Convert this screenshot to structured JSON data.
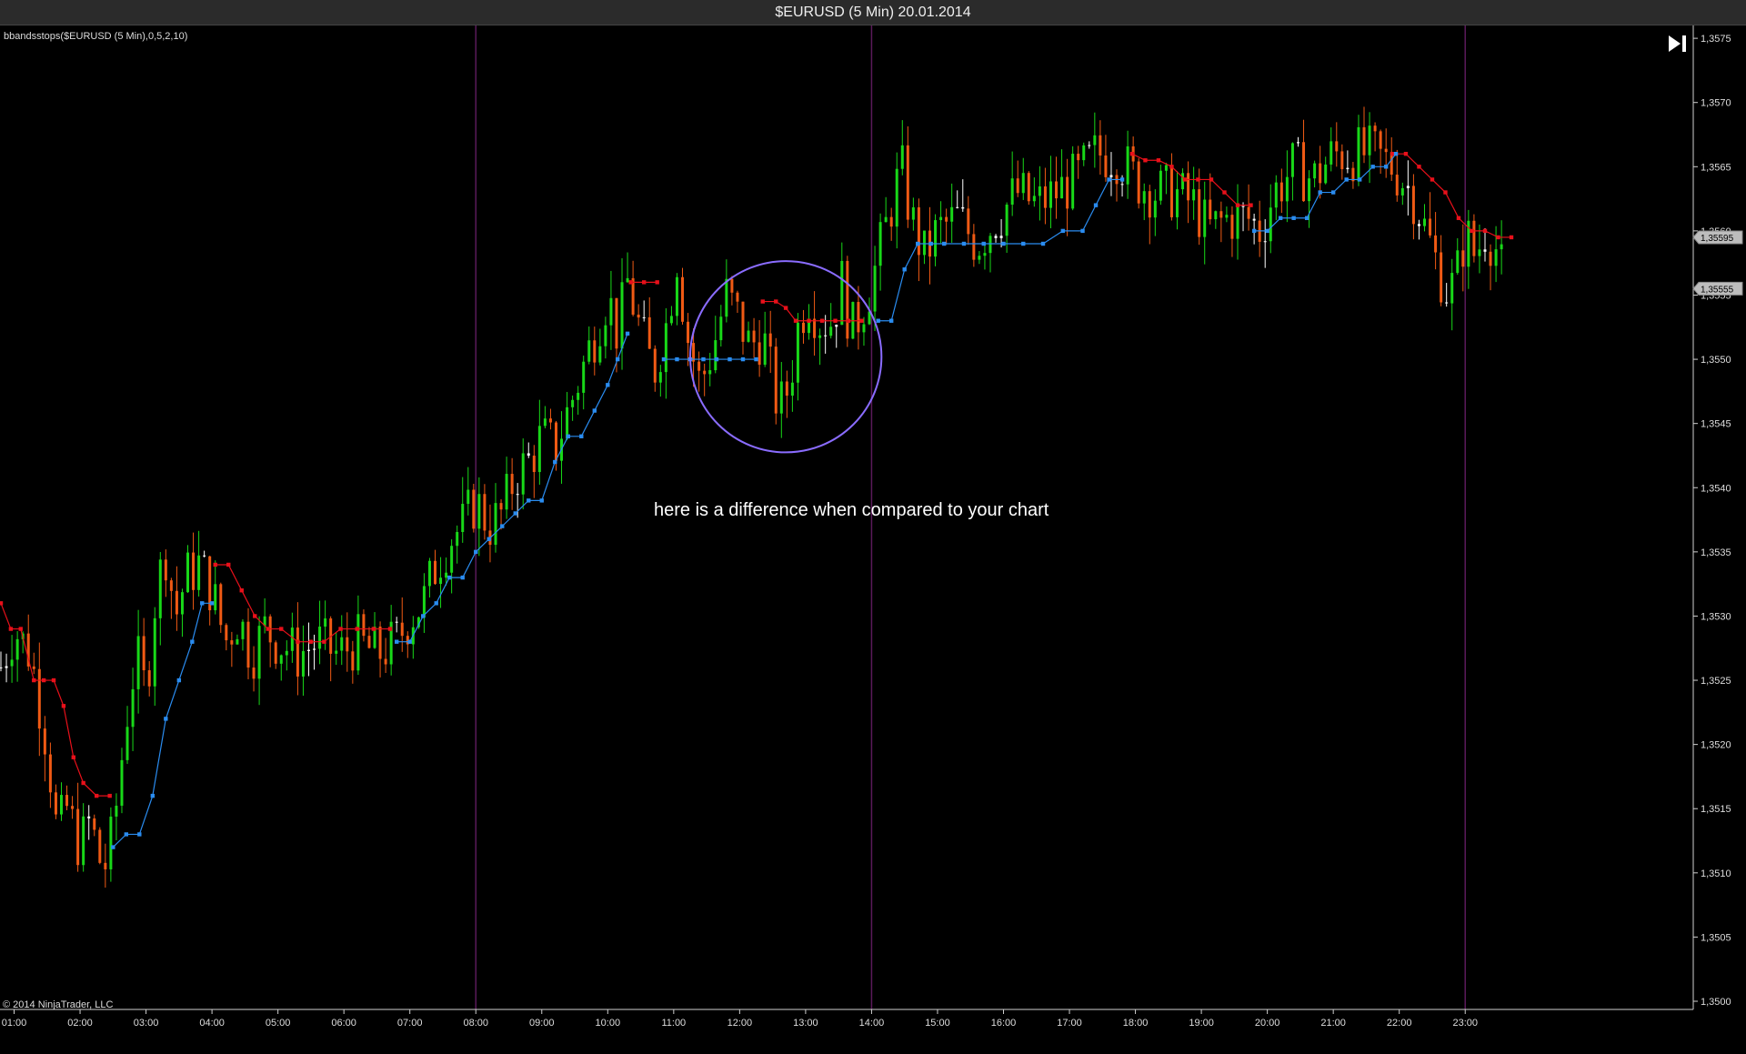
{
  "window": {
    "title": "$EURUSD (5 Min)  20.01.2014"
  },
  "chart": {
    "indicator_label": "bbandsstops($EURUSD (5 Min),0,5,2,10)",
    "copyright": "© 2014 NinjaTrader, LLC",
    "annotation": "here is a difference when compared to your chart",
    "end_button_icon": "play-end-icon"
  },
  "chart_data": {
    "type": "candlestick",
    "instrument": "$EURUSD",
    "interval": "5 Min",
    "date": "20.01.2014",
    "ylim": [
      1.35,
      1.3576
    ],
    "y_ticks": [
      "1,3575",
      "1,3570",
      "1,3565",
      "1,3560",
      "1,3555",
      "1,3550",
      "1,3545",
      "1,3540",
      "1,3535",
      "1,3530",
      "1,3525",
      "1,3520",
      "1,3515",
      "1,3510",
      "1,3505",
      "1,3500"
    ],
    "y_tick_values": [
      1.3575,
      1.357,
      1.3565,
      1.356,
      1.3555,
      1.355,
      1.3545,
      1.354,
      1.3535,
      1.353,
      1.3525,
      1.352,
      1.3515,
      1.351,
      1.3505,
      1.35
    ],
    "x_ticks": [
      "01:00",
      "02:00",
      "03:00",
      "04:00",
      "05:00",
      "06:00",
      "07:00",
      "08:00",
      "09:00",
      "10:00",
      "11:00",
      "12:00",
      "13:00",
      "14:00",
      "15:00",
      "16:00",
      "17:00",
      "18:00",
      "19:00",
      "20:00",
      "21:00",
      "22:00",
      "23:00"
    ],
    "x_tick_hours": [
      1,
      2,
      3,
      4,
      5,
      6,
      7,
      8,
      9,
      10,
      11,
      12,
      13,
      14,
      15,
      16,
      17,
      18,
      19,
      20,
      21,
      22,
      23
    ],
    "x_range_hours": [
      0.8,
      23.7
    ],
    "session_lines_hours": [
      8,
      14,
      23
    ],
    "price_markers": [
      {
        "label": "1,35595",
        "value": 1.35595
      },
      {
        "label": "1,35555",
        "value": 1.35555
      }
    ],
    "close_path": [
      [
        0.8,
        1.3526
      ],
      [
        1.0,
        1.3529
      ],
      [
        1.25,
        1.3527
      ],
      [
        1.5,
        1.352
      ],
      [
        1.65,
        1.3513
      ],
      [
        1.8,
        1.3515
      ],
      [
        2.0,
        1.3512
      ],
      [
        2.15,
        1.3514
      ],
      [
        2.35,
        1.351
      ],
      [
        2.5,
        1.3513
      ],
      [
        2.7,
        1.3522
      ],
      [
        2.85,
        1.3527
      ],
      [
        3.0,
        1.3524
      ],
      [
        3.15,
        1.3532
      ],
      [
        3.3,
        1.3535
      ],
      [
        3.45,
        1.353
      ],
      [
        3.6,
        1.3533
      ],
      [
        3.8,
        1.3534
      ],
      [
        4.0,
        1.3532
      ],
      [
        4.2,
        1.3528
      ],
      [
        4.4,
        1.353
      ],
      [
        4.6,
        1.3527
      ],
      [
        4.8,
        1.3529
      ],
      [
        5.0,
        1.3528
      ],
      [
        5.3,
        1.3527
      ],
      [
        5.6,
        1.3528
      ],
      [
        5.9,
        1.3527
      ],
      [
        6.2,
        1.3528
      ],
      [
        6.5,
        1.3527
      ],
      [
        6.8,
        1.3528
      ],
      [
        7.0,
        1.353
      ],
      [
        7.2,
        1.3531
      ],
      [
        7.4,
        1.3534
      ],
      [
        7.6,
        1.3536
      ],
      [
        7.8,
        1.3537
      ],
      [
        8.0,
        1.3539
      ],
      [
        8.2,
        1.3537
      ],
      [
        8.4,
        1.3538
      ],
      [
        8.6,
        1.3541
      ],
      [
        8.8,
        1.3542
      ],
      [
        9.0,
        1.3544
      ],
      [
        9.2,
        1.3543
      ],
      [
        9.4,
        1.3546
      ],
      [
        9.6,
        1.3549
      ],
      [
        9.8,
        1.3552
      ],
      [
        10.0,
        1.3555
      ],
      [
        10.15,
        1.3552
      ],
      [
        10.3,
        1.3556
      ],
      [
        10.5,
        1.3552
      ],
      [
        10.7,
        1.3549
      ],
      [
        10.9,
        1.3553
      ],
      [
        11.05,
        1.3558
      ],
      [
        11.2,
        1.3552
      ],
      [
        11.4,
        1.3548
      ],
      [
        11.6,
        1.3551
      ],
      [
        11.8,
        1.3555
      ],
      [
        12.0,
        1.3553
      ],
      [
        12.15,
        1.3551
      ],
      [
        12.35,
        1.3552
      ],
      [
        12.5,
        1.3548
      ],
      [
        12.6,
        1.3546
      ],
      [
        12.75,
        1.3548
      ],
      [
        12.9,
        1.3553
      ],
      [
        13.05,
        1.3555
      ],
      [
        13.2,
        1.3553
      ],
      [
        13.4,
        1.3553
      ],
      [
        13.55,
        1.3556
      ],
      [
        13.7,
        1.3552
      ],
      [
        13.85,
        1.3554
      ],
      [
        14.0,
        1.3556
      ],
      [
        14.15,
        1.3559
      ],
      [
        14.3,
        1.3562
      ],
      [
        14.45,
        1.3565
      ],
      [
        14.6,
        1.3561
      ],
      [
        14.8,
        1.3558
      ],
      [
        15.0,
        1.356
      ],
      [
        15.3,
        1.3561
      ],
      [
        15.6,
        1.3559
      ],
      [
        15.9,
        1.3561
      ],
      [
        16.2,
        1.3563
      ],
      [
        16.5,
        1.3562
      ],
      [
        16.8,
        1.3563
      ],
      [
        17.1,
        1.3564
      ],
      [
        17.4,
        1.3566
      ],
      [
        17.7,
        1.3566
      ],
      [
        18.0,
        1.3564
      ],
      [
        18.3,
        1.3563
      ],
      [
        18.6,
        1.3563
      ],
      [
        18.9,
        1.3562
      ],
      [
        19.1,
        1.356
      ],
      [
        19.4,
        1.3561
      ],
      [
        19.7,
        1.3561
      ],
      [
        19.9,
        1.356
      ],
      [
        20.1,
        1.3563
      ],
      [
        20.4,
        1.3565
      ],
      [
        20.7,
        1.3564
      ],
      [
        21.0,
        1.3566
      ],
      [
        21.3,
        1.3566
      ],
      [
        21.6,
        1.3566
      ],
      [
        21.9,
        1.3565
      ],
      [
        22.2,
        1.3563
      ],
      [
        22.4,
        1.356
      ],
      [
        22.6,
        1.3557
      ],
      [
        22.75,
        1.3555
      ],
      [
        22.9,
        1.3557
      ],
      [
        23.0,
        1.356
      ],
      [
        23.15,
        1.3558
      ],
      [
        23.3,
        1.356
      ],
      [
        23.45,
        1.3559
      ],
      [
        23.55,
        1.3557
      ],
      [
        23.6,
        1.35555
      ]
    ],
    "series": [
      {
        "name": "stop-upper",
        "color": "#e8101a",
        "values": [
          [
            0.8,
            1.3531
          ],
          [
            0.95,
            1.3529
          ],
          [
            1.1,
            1.3529
          ],
          [
            1.3,
            1.3525
          ],
          [
            1.45,
            1.3525
          ],
          [
            1.6,
            1.3525
          ],
          [
            1.75,
            1.3523
          ],
          [
            1.9,
            1.3519
          ],
          [
            2.05,
            1.3517
          ],
          [
            2.25,
            1.3516
          ],
          [
            2.45,
            1.3516
          ]
        ]
      },
      {
        "name": "stop-upper",
        "color": "#e8101a",
        "values": [
          [
            4.05,
            1.3534
          ],
          [
            4.25,
            1.3534
          ],
          [
            4.45,
            1.3532
          ],
          [
            4.65,
            1.353
          ],
          [
            4.85,
            1.3529
          ],
          [
            5.05,
            1.3529
          ],
          [
            5.3,
            1.3528
          ],
          [
            5.5,
            1.3528
          ],
          [
            5.7,
            1.3528
          ],
          [
            5.95,
            1.3529
          ],
          [
            6.2,
            1.3529
          ],
          [
            6.45,
            1.3529
          ],
          [
            6.7,
            1.3529
          ]
        ]
      },
      {
        "name": "stop-upper",
        "color": "#e8101a",
        "values": [
          [
            10.35,
            1.3556
          ],
          [
            10.55,
            1.3556
          ],
          [
            10.75,
            1.3556
          ]
        ]
      },
      {
        "name": "stop-upper",
        "color": "#e8101a",
        "values": [
          [
            12.35,
            1.35545
          ],
          [
            12.55,
            1.35545
          ],
          [
            12.7,
            1.3554
          ],
          [
            12.85,
            1.3553
          ],
          [
            13.05,
            1.3553
          ],
          [
            13.25,
            1.3553
          ],
          [
            13.45,
            1.3553
          ],
          [
            13.65,
            1.3553
          ],
          [
            13.85,
            1.3553
          ]
        ]
      },
      {
        "name": "stop-upper",
        "color": "#e8101a",
        "values": [
          [
            17.95,
            1.3566
          ],
          [
            18.15,
            1.35655
          ],
          [
            18.35,
            1.35655
          ],
          [
            18.55,
            1.3565
          ],
          [
            18.75,
            1.3564
          ],
          [
            18.95,
            1.3564
          ],
          [
            19.15,
            1.3564
          ],
          [
            19.35,
            1.3563
          ],
          [
            19.55,
            1.3562
          ],
          [
            19.75,
            1.3562
          ]
        ]
      },
      {
        "name": "stop-upper",
        "color": "#e8101a",
        "values": [
          [
            21.9,
            1.3566
          ],
          [
            22.1,
            1.3566
          ],
          [
            22.3,
            1.3565
          ],
          [
            22.5,
            1.3564
          ],
          [
            22.7,
            1.3563
          ],
          [
            22.9,
            1.3561
          ],
          [
            23.1,
            1.356
          ],
          [
            23.3,
            1.356
          ],
          [
            23.5,
            1.35595
          ],
          [
            23.7,
            1.35595
          ]
        ]
      },
      {
        "name": "stop-lower",
        "color": "#2a8cf0",
        "values": [
          [
            2.5,
            1.3512
          ],
          [
            2.7,
            1.3513
          ],
          [
            2.9,
            1.3513
          ],
          [
            3.1,
            1.3516
          ],
          [
            3.3,
            1.3522
          ],
          [
            3.5,
            1.3525
          ],
          [
            3.7,
            1.3528
          ],
          [
            3.85,
            1.3531
          ],
          [
            4.0,
            1.3531
          ]
        ]
      },
      {
        "name": "stop-lower",
        "color": "#2a8cf0",
        "values": [
          [
            6.8,
            1.3528
          ],
          [
            7.0,
            1.3528
          ],
          [
            7.2,
            1.353
          ],
          [
            7.4,
            1.3531
          ],
          [
            7.6,
            1.3533
          ],
          [
            7.8,
            1.3533
          ],
          [
            8.0,
            1.3535
          ],
          [
            8.2,
            1.3536
          ],
          [
            8.4,
            1.3537
          ],
          [
            8.6,
            1.3538
          ],
          [
            8.8,
            1.3539
          ],
          [
            9.0,
            1.3539
          ],
          [
            9.2,
            1.3542
          ],
          [
            9.4,
            1.3544
          ],
          [
            9.6,
            1.3544
          ],
          [
            9.8,
            1.3546
          ],
          [
            10.0,
            1.3548
          ],
          [
            10.15,
            1.355
          ],
          [
            10.3,
            1.3552
          ]
        ]
      },
      {
        "name": "stop-lower",
        "color": "#2a8cf0",
        "values": [
          [
            10.85,
            1.355
          ],
          [
            11.05,
            1.355
          ],
          [
            11.25,
            1.355
          ],
          [
            11.45,
            1.355
          ],
          [
            11.65,
            1.355
          ],
          [
            11.85,
            1.355
          ],
          [
            12.05,
            1.355
          ],
          [
            12.25,
            1.355
          ]
        ]
      },
      {
        "name": "stop-lower",
        "color": "#2a8cf0",
        "values": [
          [
            14.1,
            1.3553
          ],
          [
            14.3,
            1.3553
          ],
          [
            14.5,
            1.3557
          ],
          [
            14.7,
            1.3559
          ],
          [
            14.9,
            1.3559
          ],
          [
            15.1,
            1.3559
          ],
          [
            15.4,
            1.3559
          ],
          [
            15.7,
            1.3559
          ],
          [
            16.0,
            1.3559
          ],
          [
            16.3,
            1.3559
          ],
          [
            16.6,
            1.3559
          ],
          [
            16.9,
            1.356
          ],
          [
            17.2,
            1.356
          ],
          [
            17.4,
            1.3562
          ],
          [
            17.6,
            1.3564
          ],
          [
            17.8,
            1.3564
          ]
        ]
      },
      {
        "name": "stop-lower",
        "color": "#2a8cf0",
        "values": [
          [
            19.8,
            1.356
          ],
          [
            20.0,
            1.356
          ],
          [
            20.2,
            1.3561
          ],
          [
            20.4,
            1.3561
          ],
          [
            20.6,
            1.3561
          ],
          [
            20.8,
            1.3563
          ],
          [
            21.0,
            1.3563
          ],
          [
            21.2,
            1.3564
          ],
          [
            21.4,
            1.3564
          ],
          [
            21.6,
            1.3565
          ],
          [
            21.8,
            1.3565
          ],
          [
            21.95,
            1.3566
          ]
        ]
      }
    ],
    "highlight_circle": {
      "center": [
        12.7,
        1.35502
      ],
      "radius_hours": 1.45
    }
  },
  "colors": {
    "background": "#000000",
    "bull": "#18d818",
    "bear": "#f05a14",
    "doji": "#ffffff",
    "session_line": "#5a1a5a",
    "grid_axis": "#cfcfcf",
    "circle": "#8a6cff"
  }
}
